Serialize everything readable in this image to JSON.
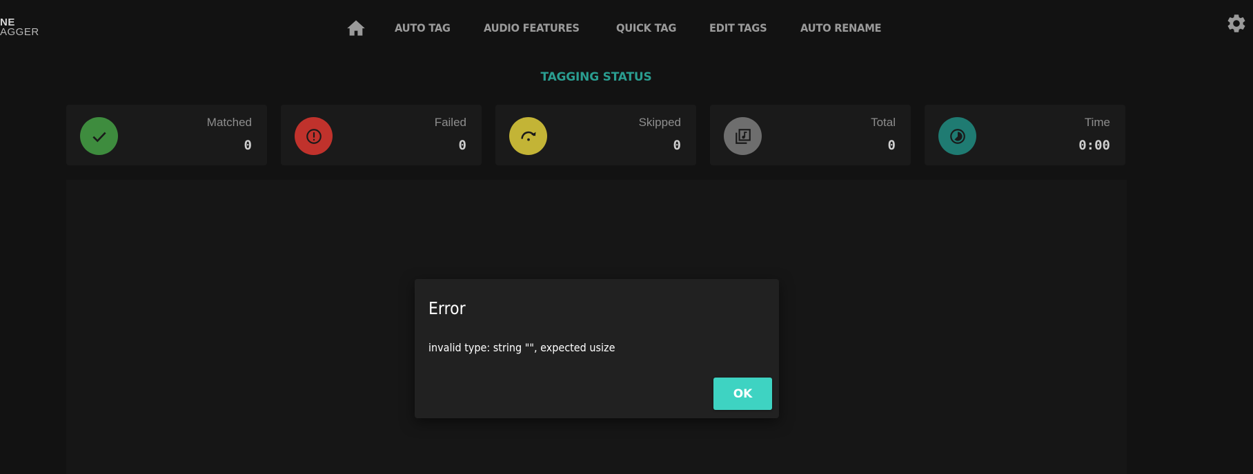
{
  "logo": {
    "line1": "NE",
    "line2": "AGGER"
  },
  "nav": {
    "home_icon": "home-icon",
    "items": [
      "AUTO TAG",
      "AUDIO FEATURES",
      "QUICK TAG",
      "EDIT TAGS",
      "AUTO RENAME"
    ],
    "settings_icon": "gear-icon"
  },
  "status": {
    "title": "TAGGING STATUS",
    "cards": [
      {
        "label": "Matched",
        "value": "0",
        "icon": "check-icon",
        "color": "#3e8c3e"
      },
      {
        "label": "Failed",
        "value": "0",
        "icon": "alert-circle-icon",
        "color": "#c0322c"
      },
      {
        "label": "Skipped",
        "value": "0",
        "icon": "redo-icon",
        "color": "#c3b436"
      },
      {
        "label": "Total",
        "value": "0",
        "icon": "music-library-icon",
        "color": "#6e6e6e"
      },
      {
        "label": "Time",
        "value": "0:00",
        "icon": "timelapse-icon",
        "color": "#1f7b72"
      }
    ]
  },
  "dialog": {
    "title": "Error",
    "message": "invalid type: string \"\", expected usize",
    "ok_label": "OK"
  },
  "colors": {
    "accent": "#2a9d90",
    "ok_button": "#3ed3c2",
    "background": "#121212"
  }
}
